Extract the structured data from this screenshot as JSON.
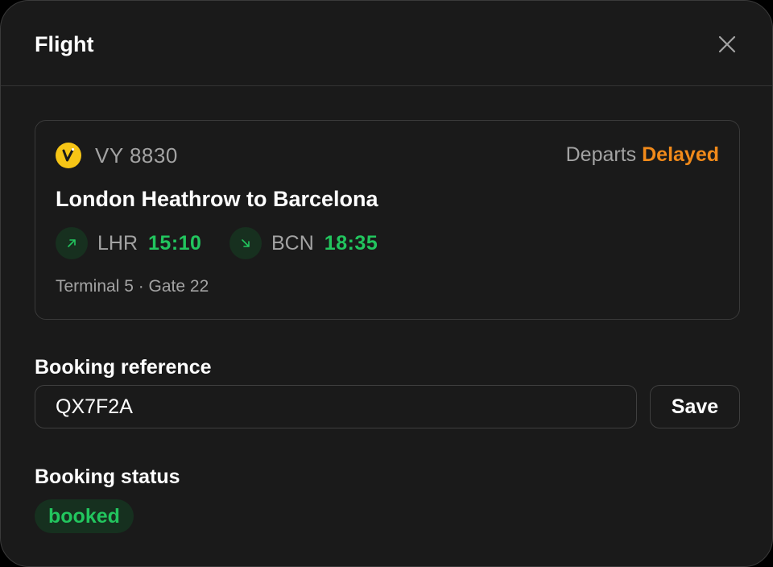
{
  "dialog": {
    "title": "Flight",
    "close_icon": "close-icon"
  },
  "flight": {
    "airline_logo_icon": "airline-logo-icon",
    "airline_logo_color": "#f6c516",
    "number": "VY 8830",
    "departs_label": "Departs",
    "departs_status": "Delayed",
    "departs_status_color": "#f18a1a",
    "route": "London Heathrow to Barcelona",
    "departure": {
      "icon": "arrow-up-right-icon",
      "code": "LHR",
      "time": "15:10"
    },
    "arrival": {
      "icon": "arrow-down-right-icon",
      "code": "BCN",
      "time": "18:35"
    },
    "time_color": "#22c55e",
    "terminal_gate": "Terminal 5 · Gate 22"
  },
  "booking_reference": {
    "label": "Booking reference",
    "value": "QX7F2A",
    "save_label": "Save"
  },
  "booking_status": {
    "label": "Booking status",
    "value": "booked",
    "color": "#22c55e"
  }
}
